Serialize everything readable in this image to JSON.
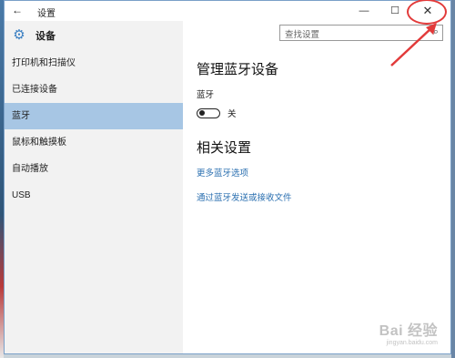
{
  "window": {
    "title": "设置",
    "back_glyph": "←",
    "minimize_glyph": "—",
    "maximize_glyph": "☐",
    "close_glyph": "✕"
  },
  "sidebar": {
    "title": "设备",
    "items": [
      {
        "label": "打印机和扫描仪",
        "active": false
      },
      {
        "label": "已连接设备",
        "active": false
      },
      {
        "label": "蓝牙",
        "active": true
      },
      {
        "label": "鼠标和触摸板",
        "active": false
      },
      {
        "label": "自动播放",
        "active": false
      },
      {
        "label": "USB",
        "active": false
      }
    ]
  },
  "search": {
    "placeholder": "查找设置"
  },
  "main": {
    "heading": "管理蓝牙设备",
    "bluetooth_label": "蓝牙",
    "toggle_state": "关",
    "related_heading": "相关设置",
    "links": [
      "更多蓝牙选项",
      "通过蓝牙发送或接收文件"
    ]
  },
  "watermark": {
    "logo": "Bai 经验",
    "url": "jingyan.baidu.com"
  },
  "colors": {
    "accent": "#3a7fc2",
    "active_item": "#a7c6e4",
    "annotation": "#e23a3a",
    "link": "#2a6fb0"
  }
}
